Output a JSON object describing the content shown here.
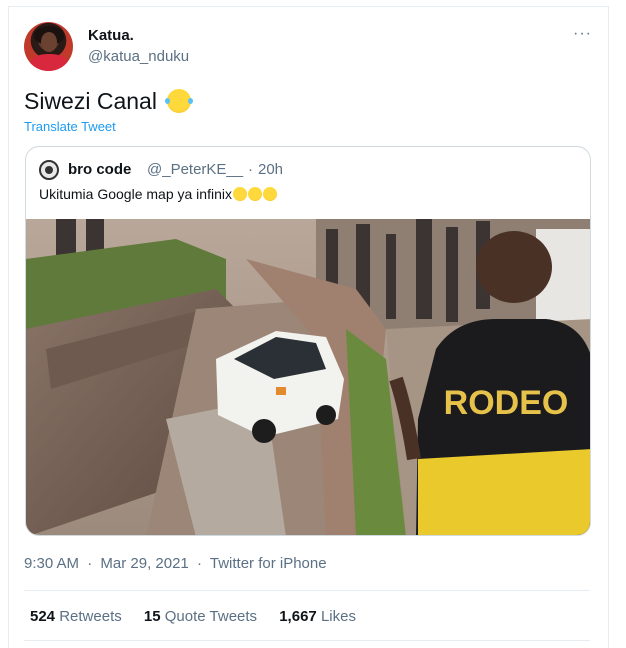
{
  "author": {
    "display_name": "Katua.",
    "handle": "@katua_nduku"
  },
  "tweet": {
    "text": "Siwezi Canal",
    "emoji": "face-with-tears-of-joy",
    "translate_label": "Translate Tweet"
  },
  "quoted": {
    "display_name": "bro code",
    "handle": "@_PeterKE__",
    "separator": "·",
    "time": "20h",
    "text": "Ukitumia Google map ya infinix",
    "emoji_count": 3,
    "photo_shirt_text": "RODEO"
  },
  "meta": {
    "time": "9:30 AM",
    "sep1": "·",
    "date": "Mar 29, 2021",
    "sep2": "·",
    "source": "Twitter for iPhone"
  },
  "stats": {
    "retweets": "524",
    "retweets_label": "Retweets",
    "quote_tweets": "15",
    "quote_tweets_label": "Quote Tweets",
    "likes": "1,667",
    "likes_label": "Likes"
  },
  "more_icon": "···",
  "colors": {
    "link": "#1d9bf0",
    "secondary_text": "#5b7083",
    "border": "#cfd9de"
  }
}
